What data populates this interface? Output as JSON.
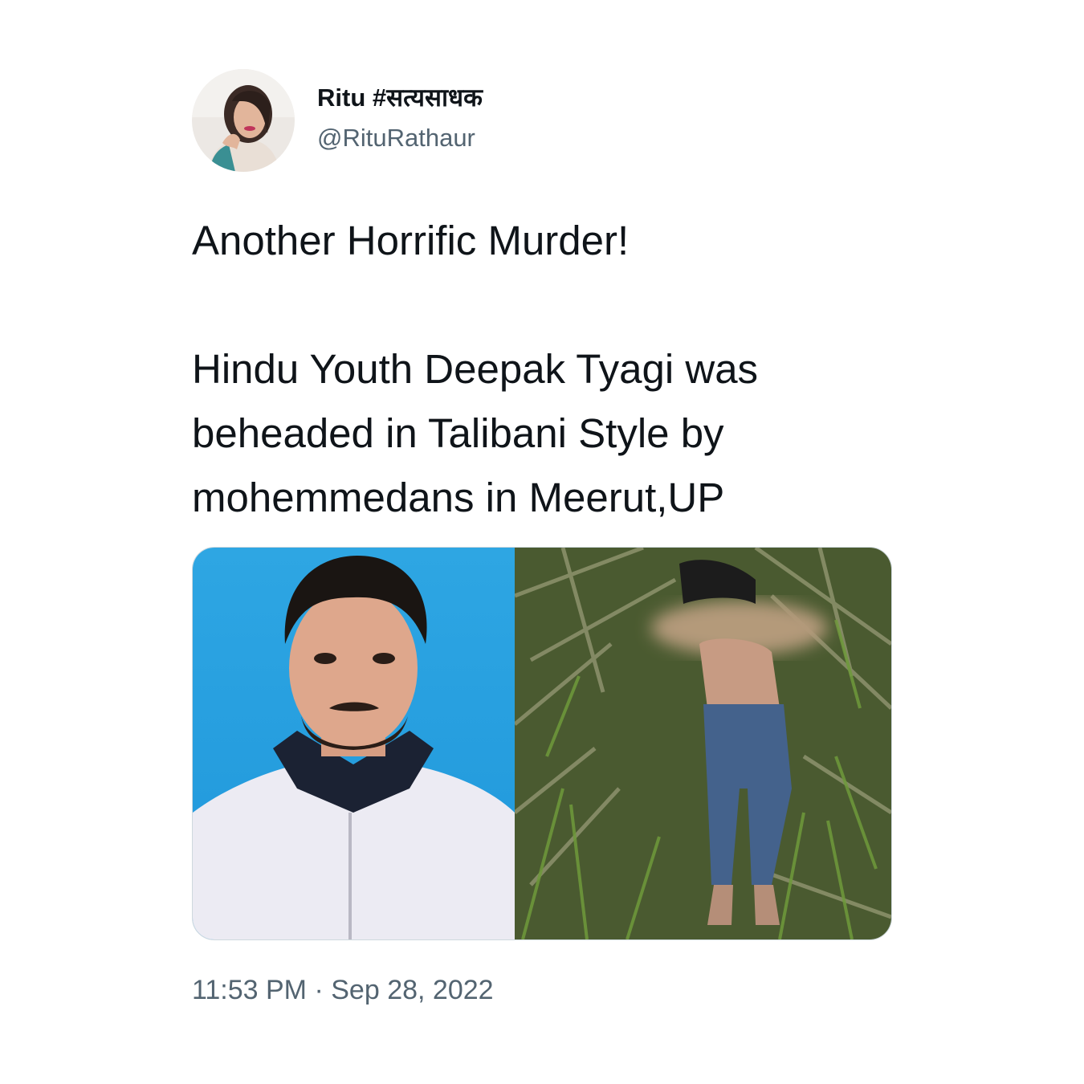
{
  "tweet": {
    "author": {
      "display_name": "Ritu #सत्यसाधक",
      "handle": "@RituRathaur",
      "avatar_icon": "user-avatar-photo"
    },
    "text": {
      "line1": "Another Horrific Murder!",
      "line2": "Hindu Youth Deepak Tyagi was beheaded in Talibani Style by mohemmedans in Meerut,UP"
    },
    "media": [
      {
        "kind": "photo",
        "subject": "portrait"
      },
      {
        "kind": "photo",
        "subject": "blurred-field-photo"
      }
    ],
    "time": "11:53 PM",
    "separator": "·",
    "date": "Sep 28, 2022"
  },
  "colors": {
    "text_primary": "#0f1419",
    "text_secondary": "#536471",
    "border": "#cfd9de",
    "portrait_bg": "#2aa3e0"
  }
}
